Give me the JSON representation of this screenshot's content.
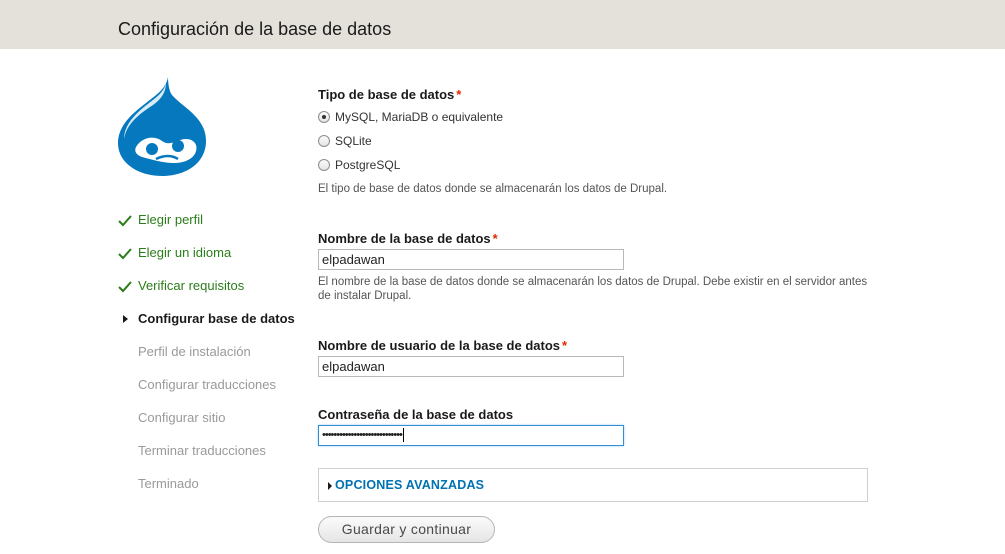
{
  "header": {
    "title": "Configuración de la base de datos"
  },
  "colors": {
    "done": "#2b7d1b",
    "pending": "#9a9a9a",
    "link": "#0071b3",
    "required": "#e32700",
    "logo": "#0678be"
  },
  "logo": {
    "icon": "drupal-drop-logo"
  },
  "steps": [
    {
      "label": "Elegir perfil",
      "status": "done"
    },
    {
      "label": "Elegir un idioma",
      "status": "done"
    },
    {
      "label": "Verificar requisitos",
      "status": "done"
    },
    {
      "label": "Configurar base de datos",
      "status": "active"
    },
    {
      "label": "Perfil de instalación",
      "status": "pending"
    },
    {
      "label": "Configurar traducciones",
      "status": "pending"
    },
    {
      "label": "Configurar sitio",
      "status": "pending"
    },
    {
      "label": "Terminar traducciones",
      "status": "pending"
    },
    {
      "label": "Terminado",
      "status": "pending"
    }
  ],
  "form": {
    "db_type": {
      "label": "Tipo de base de datos",
      "required_mark": "*",
      "options": [
        {
          "label": "MySQL, MariaDB o equivalente",
          "checked": true
        },
        {
          "label": "SQLite",
          "checked": false
        },
        {
          "label": "PostgreSQL",
          "checked": false
        }
      ],
      "description": "El tipo de base de datos donde se almacenarán los datos de Drupal."
    },
    "db_name": {
      "label": "Nombre de la base de datos",
      "required_mark": "*",
      "value": "elpadawan",
      "description": "El nombre de la base de datos donde se almacenarán los datos de Drupal. Debe existir en el servidor antes de instalar Drupal."
    },
    "db_user": {
      "label": "Nombre de usuario de la base de datos",
      "required_mark": "*",
      "value": "elpadawan"
    },
    "db_pass": {
      "label": "Contraseña de la base de datos",
      "masked_value": "••••••••••••••••••••••••••••"
    },
    "advanced": {
      "label": "OPCIONES AVANZADAS"
    },
    "submit_label": "Guardar y continuar"
  }
}
